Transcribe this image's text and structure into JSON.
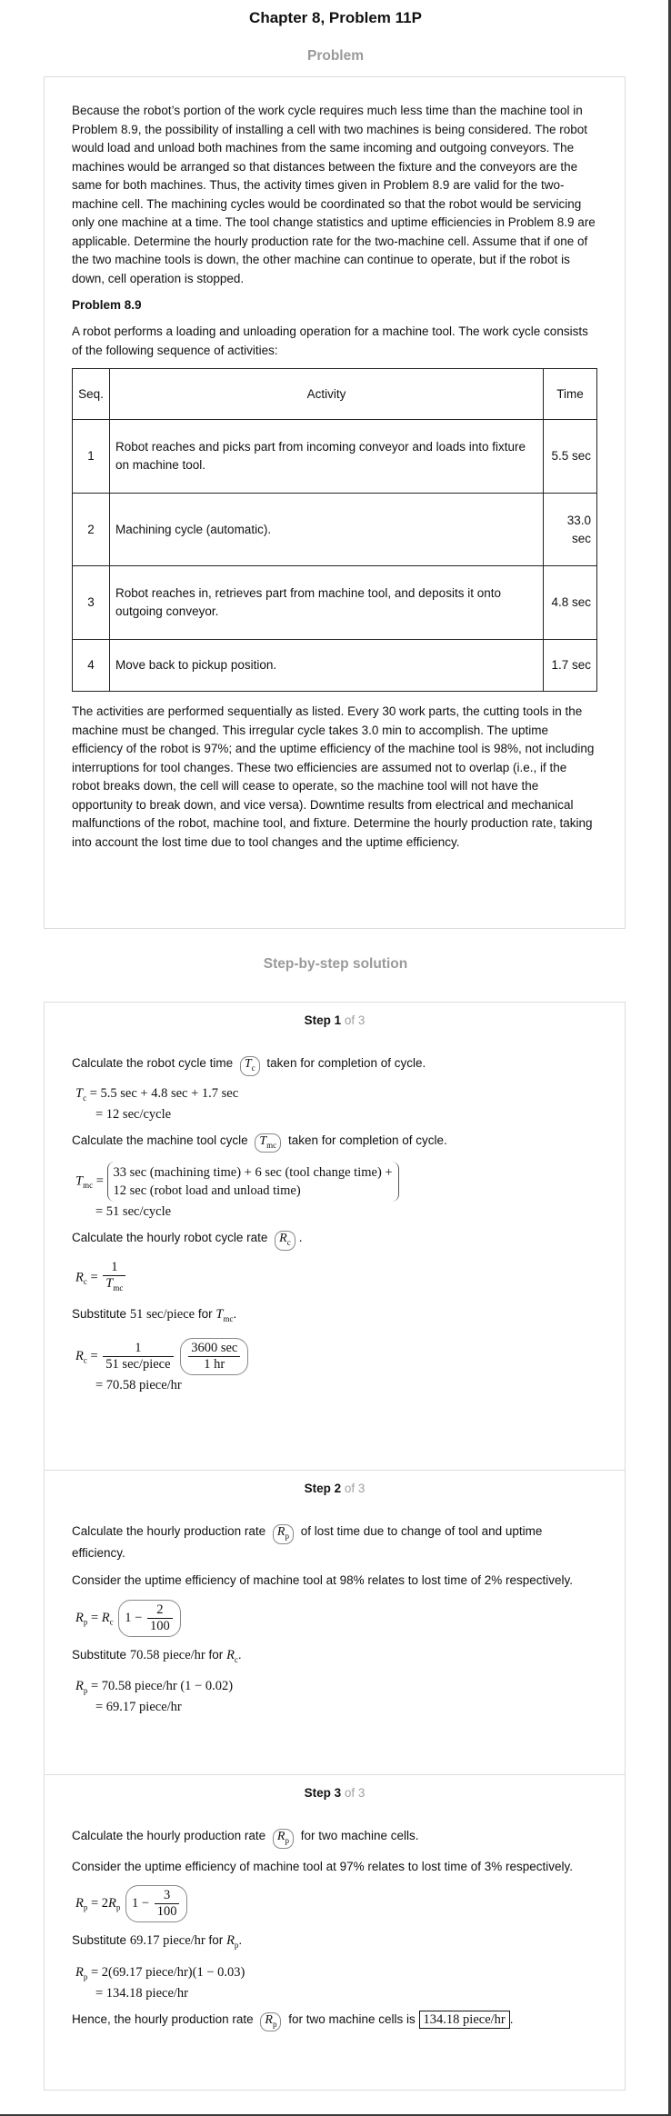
{
  "header": {
    "title": "Chapter 8, Problem 11P",
    "problem_label": "Problem",
    "solution_label": "Step-by-step solution"
  },
  "problem": {
    "intro": "Because the robot’s portion of the work cycle requires much less time than the machine tool in Problem 8.9, the possibility of installing a cell with two machines is being considered. The robot would load and unload both machines from the same incoming and outgoing conveyors. The machines would be arranged so that distances between the fixture and the conveyors are the same for both machines. Thus, the activity times given in Problem 8.9 are valid for the two-machine cell. The machining cycles would be coordinated so that the robot would be servicing only one machine at a time. The tool change statistics and uptime efficiencies in Problem 8.9 are applicable. Determine the hourly production rate for the two-machine cell. Assume that if one of the two machine tools is down, the other machine can continue to operate, but if the robot is down, cell operation is stopped.",
    "ref_heading": "Problem 8.9",
    "ref_intro": "A robot performs a loading and unloading operation for a machine tool. The work cycle consists of the following sequence of activities:",
    "table": {
      "headers": [
        "Seq.",
        "Activity",
        "Time"
      ],
      "rows": [
        {
          "seq": "1",
          "activity": "Robot reaches and picks part from incoming conveyor and loads into fixture on machine tool.",
          "time": "5.5 sec"
        },
        {
          "seq": "2",
          "activity": "Machining cycle (automatic).",
          "time": "33.0 sec"
        },
        {
          "seq": "3",
          "activity": "Robot reaches in, retrieves part from machine tool, and deposits it onto outgoing conveyor.",
          "time": "4.8 sec"
        },
        {
          "seq": "4",
          "activity": "Move back to pickup position.",
          "time": "1.7 sec"
        }
      ]
    },
    "ref_outro": "The activities are performed sequentially as listed. Every 30 work parts, the cutting tools in the machine must be changed. This irregular cycle takes 3.0 min to accomplish. The uptime efficiency of the robot is 97%; and the uptime efficiency of the machine tool is 98%, not including interruptions for tool changes. These two efficiencies are assumed not to overlap (i.e., if the robot breaks down, the cell will cease to operate, so the machine tool will not have the opportunity to break down, and vice versa). Downtime results from electrical and mechanical malfunctions of the robot, machine tool, and fixture. Determine the hourly production rate, taking into account the lost time due to tool changes and the uptime efficiency."
  },
  "steps": [
    {
      "label": "Step 1",
      "of": "of 3",
      "t1": "Calculate the robot cycle time",
      "t1b": "taken for completion of cycle.",
      "eq1a": "= 5.5 sec + 4.8 sec + 1.7 sec",
      "eq1b": "= 12 sec/cycle",
      "t2": "Calculate the machine tool cycle",
      "t2b": "taken for completion of cycle.",
      "eq2a": "33 sec (machining time) + 6 sec (tool change time) +",
      "eq2b": "12 sec (robot load and unload time)",
      "eq2c": "= 51 sec/cycle",
      "t3": "Calculate the hourly robot cycle rate",
      "t4a": "Substitute",
      "t4val": "51 sec/piece",
      "t4for": "for",
      "frac_num": "3600 sec",
      "frac_den": "1 hr",
      "frac2_den": "51 sec/piece",
      "eq4": "= 70.58 piece/hr"
    },
    {
      "label": "Step 2",
      "of": "of 3",
      "t1": "Calculate the hourly production rate",
      "t1b": "of lost time due to change of tool and uptime efficiency.",
      "t2": "Consider the uptime efficiency of machine tool at 98% relates to lost time of 2% respectively.",
      "num": "2",
      "den": "100",
      "t3a": "Substitute",
      "t3val": "70.58 piece/hr",
      "t3for": "for",
      "eq3a": "= 70.58 piece/hr (1 − 0.02)",
      "eq3b": "= 69.17 piece/hr"
    },
    {
      "label": "Step 3",
      "of": "of 3",
      "t1": "Calculate the hourly production rate",
      "t1b": "for two machine cells.",
      "t2": "Consider the uptime efficiency of machine tool at 97% relates to lost time of 3% respectively.",
      "num": "3",
      "den": "100",
      "t3a": "Substitute",
      "t3val": "69.17 piece/hr",
      "t3for": "for",
      "eq3a": "= 2(69.17 piece/hr)(1 − 0.03)",
      "eq3b": "= 134.18 piece/hr",
      "t4": "Hence, the hourly production rate",
      "t4b": "for two machine cells is",
      "answer": "134.18 piece/hr"
    }
  ]
}
